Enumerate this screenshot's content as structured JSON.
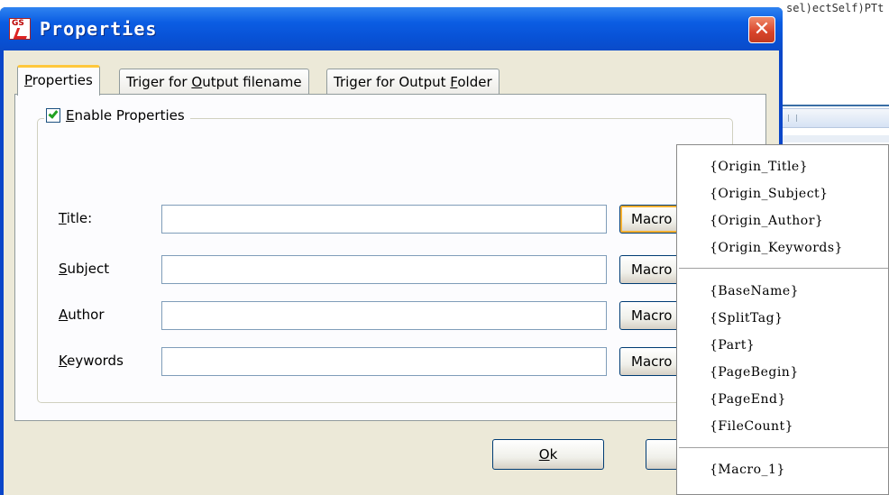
{
  "background_app": {
    "code_text": "sel)ectSelf)PTt"
  },
  "dialog": {
    "title": "Properties",
    "app_icon_text": "GS",
    "close_glyph": "✕"
  },
  "tabs": [
    {
      "label_prefix": "",
      "mnemonic": "P",
      "label_suffix": "roperties"
    },
    {
      "label_prefix": "Triger for ",
      "mnemonic": "O",
      "label_suffix": "utput filename"
    },
    {
      "label_prefix": "Triger for Output ",
      "mnemonic": "F",
      "label_suffix": "older"
    }
  ],
  "group": {
    "checkbox_checked": true,
    "mnemonic": "E",
    "label_suffix": "nable Properties"
  },
  "fields": [
    {
      "mnemonic": "T",
      "label_suffix": "itle:",
      "value": "",
      "macro_label": "Macro"
    },
    {
      "mnemonic": "S",
      "label_suffix": "ubject",
      "value": "",
      "macro_label": "Macro"
    },
    {
      "mnemonic": "A",
      "label_suffix": "uthor",
      "value": "",
      "macro_label": "Macro"
    },
    {
      "mnemonic": "K",
      "label_suffix": "eywords",
      "value": "",
      "macro_label": "Macro"
    }
  ],
  "buttons": {
    "ok_mnemonic": "O",
    "ok_suffix": "k"
  },
  "macro_menu": {
    "group1": [
      "{Origin_Title}",
      "{Origin_Subject}",
      "{Origin_Author}",
      "{Origin_Keywords}"
    ],
    "group2": [
      "{BaseName}",
      "{SplitTag}",
      "{Part}",
      "{PageBegin}",
      "{PageEnd}",
      "{FileCount}"
    ],
    "group3": [
      "{Macro_1}"
    ]
  },
  "colors": {
    "titlebar": "#0b5de3",
    "client": "#ece9d8",
    "tab_highlight": "#ffc83c",
    "checkmark": "#21a121"
  }
}
